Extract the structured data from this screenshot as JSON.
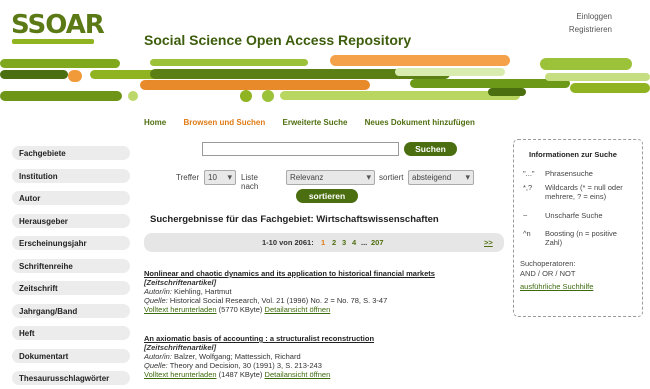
{
  "header": {
    "logo_text": "SSOAR",
    "site_title": "Social Science Open Access Repository",
    "login": "Einloggen",
    "register": "Registrieren"
  },
  "mainnav": [
    {
      "label": "Home",
      "active": false
    },
    {
      "label": "Browsen und Suchen",
      "active": true
    },
    {
      "label": "Erweiterte Suche",
      "active": false
    },
    {
      "label": "Neues Dokument hinzufügen",
      "active": false
    }
  ],
  "sidebar": {
    "items": [
      "Fachgebiete",
      "Institution",
      "Autor",
      "Herausgeber",
      "Erscheinungsjahr",
      "Schriftenreihe",
      "Zeitschrift",
      "Jahrgang/Band",
      "Heft",
      "Dokumentart",
      "Thesaurusschlagwörter"
    ]
  },
  "search": {
    "value": "",
    "button_label": "Suchen"
  },
  "filters": {
    "treffer_label": "Treffer",
    "treffer_value": "10",
    "liste_label": "Liste nach",
    "liste_value": "Relevanz",
    "sortiert_label": "sortiert",
    "sortiert_value": "absteigend",
    "sort_button": "sortieren"
  },
  "results": {
    "heading": "Suchergebnisse für das Fachgebiet: Wirtschaftswissenschaften",
    "pager_text": "1-10 von 2061:",
    "pages": [
      "1",
      "2",
      "3",
      "4",
      "...",
      "207"
    ],
    "current_page": "1",
    "next_label": ">>",
    "items": [
      {
        "title": "Nonlinear and chaotic dynamics and its application to historical financial markets",
        "type": "[Zeitschriftenartikel]",
        "author_label": "Autor/in:",
        "author": "Kiehling, Hartmut",
        "source_label": "Quelle:",
        "source": "Historical Social Research, Vol. 21 (1996) No. 2 = No. 78, S. 3-47",
        "download_label": "Volltext herunterladen",
        "size": "(5770 KByte)",
        "detail_label": "Detailansicht öffnen"
      },
      {
        "title": "An axiomatic basis of accounting : a structuralist reconstruction",
        "type": "[Zeitschriftenartikel]",
        "author_label": "Autor/in:",
        "author": "Balzer, Wolfgang; Mattessich, Richard",
        "source_label": "Quelle:",
        "source": "Theory and Decision, 30 (1991) 3, S. 213-243",
        "download_label": "Volltext herunterladen",
        "size": "(1487 KByte)",
        "detail_label": "Detailansicht öffnen"
      }
    ]
  },
  "infobox": {
    "title": "Informationen zur Suche",
    "rows": [
      {
        "symbol": "\"...\"",
        "desc": "Phrasensuche"
      },
      {
        "symbol": "*,?",
        "desc": "Wildcards (* = null oder mehrere, ? = eins)"
      },
      {
        "symbol": "~",
        "desc": "Unscharfe Suche"
      },
      {
        "symbol": "^n",
        "desc": "Boosting (n = positive Zahl)"
      }
    ],
    "operators_label": "Suchoperatoren:",
    "operators": "AND / OR / NOT",
    "help_link": "ausführliche Suchhilfe"
  },
  "colors": {
    "brand_green": "#4b6f10",
    "light_green": "#8fb321",
    "accent_orange": "#e07b16"
  }
}
